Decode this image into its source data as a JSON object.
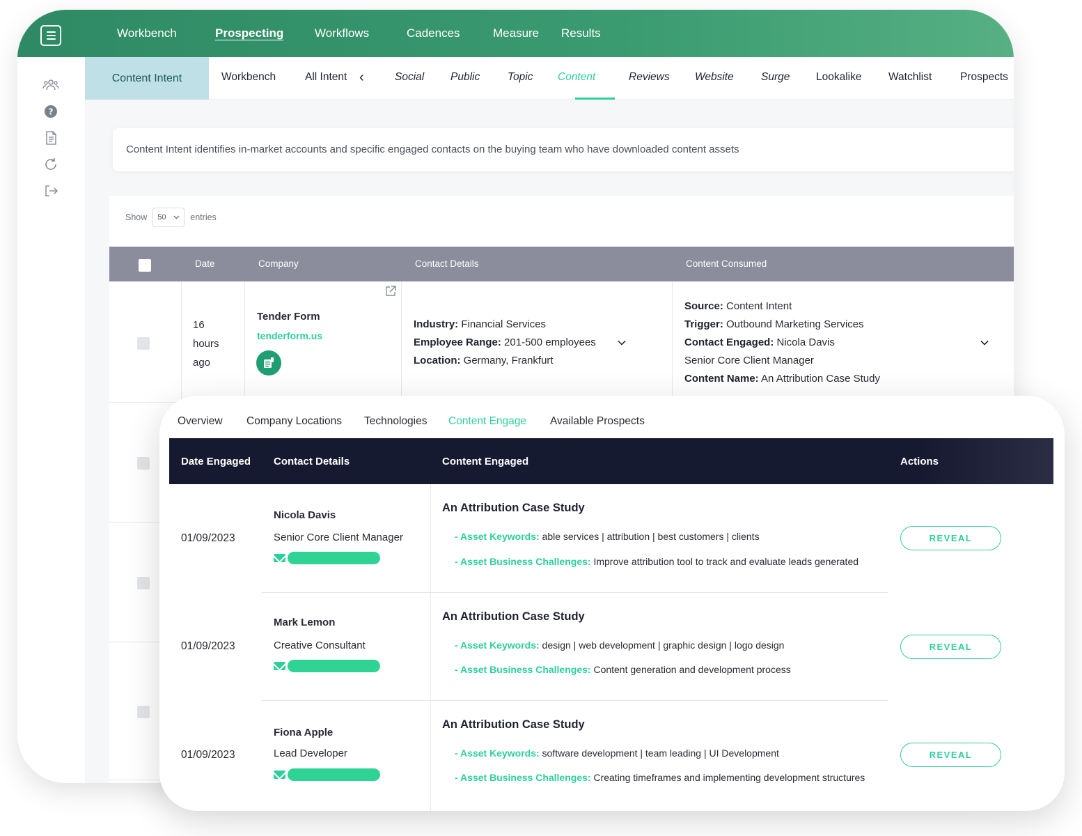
{
  "topnav": {
    "items": [
      "Workbench",
      "Prospecting",
      "Workflows",
      "Cadences",
      "Measure",
      "Results"
    ],
    "active": "Prospecting"
  },
  "sidebar": {
    "icons": [
      "users-icon",
      "help-icon",
      "document-icon",
      "refresh-icon",
      "logout-icon"
    ]
  },
  "subnav": {
    "title": "Content Intent",
    "tabs": [
      "Workbench",
      "All Intent",
      "Social",
      "Public",
      "Topic",
      "Content",
      "Reviews",
      "Website",
      "Surge",
      "Lookalike",
      "Watchlist",
      "Prospects"
    ],
    "active": "Content"
  },
  "description": "Content Intent identifies in-market accounts and specific engaged contacts on the buying team who have downloaded content assets",
  "table": {
    "show_label": "Show",
    "entries_value": "50",
    "entries_label": "entries",
    "columns": [
      "Date",
      "Company",
      "Contact Details",
      "Content Consumed"
    ],
    "row1": {
      "date_lines": [
        "16",
        "hours",
        "ago"
      ],
      "company_name": "Tender Form",
      "company_domain": "tenderform.us",
      "industry_label": "Industry:",
      "industry": "Financial Services",
      "employee_label": "Employee Range:",
      "employee": "201-500 employees",
      "location_label": "Location:",
      "location": "Germany, Frankfurt",
      "source_label": "Source:",
      "source": "Content Intent",
      "trigger_label": "Trigger:",
      "trigger": "Outbound Marketing Services",
      "contact_label": "Contact Engaged:",
      "contact": "Nicola Davis",
      "contact_title": "Senior Core Client Manager",
      "content_label": "Content Name:",
      "content": "An Attribution Case Study"
    }
  },
  "detail": {
    "tabs": [
      "Overview",
      "Company Locations",
      "Technologies",
      "Content Engage",
      "Available Prospects"
    ],
    "active_tab": "Content Engage",
    "columns": [
      "Date Engaged",
      "Contact Details",
      "Content Engaged",
      "Actions"
    ],
    "keywords_label": "Asset Keywords:",
    "challenges_label": "Asset Business Challenges:",
    "reveal_label": "REVEAL",
    "rows": [
      {
        "date": "01/09/2023",
        "name": "Nicola Davis",
        "title": "Senior Core Client Manager",
        "content_title": "An Attribution Case Study",
        "keywords": "able services | attribution | best customers | clients",
        "challenges": "Improve attribution tool to track and evaluate leads generated"
      },
      {
        "date": "01/09/2023",
        "name": "Mark Lemon",
        "title": "Creative Consultant",
        "content_title": "An Attribution Case Study",
        "keywords": "design | web development | graphic design | logo design",
        "challenges": "Content generation and development process"
      },
      {
        "date": "01/09/2023",
        "name": "Fiona Apple",
        "title": "Lead Developer",
        "content_title": "An Attribution Case Study",
        "keywords": "software development | team leading | UI Development",
        "challenges": "Creating timeframes and implementing development structures"
      }
    ]
  },
  "colors": {
    "brand_green": "#2ecf9c",
    "header_dark": "#161a30",
    "topbar_green": "#2e8a64",
    "table_header_grey": "#8b8d9c"
  }
}
